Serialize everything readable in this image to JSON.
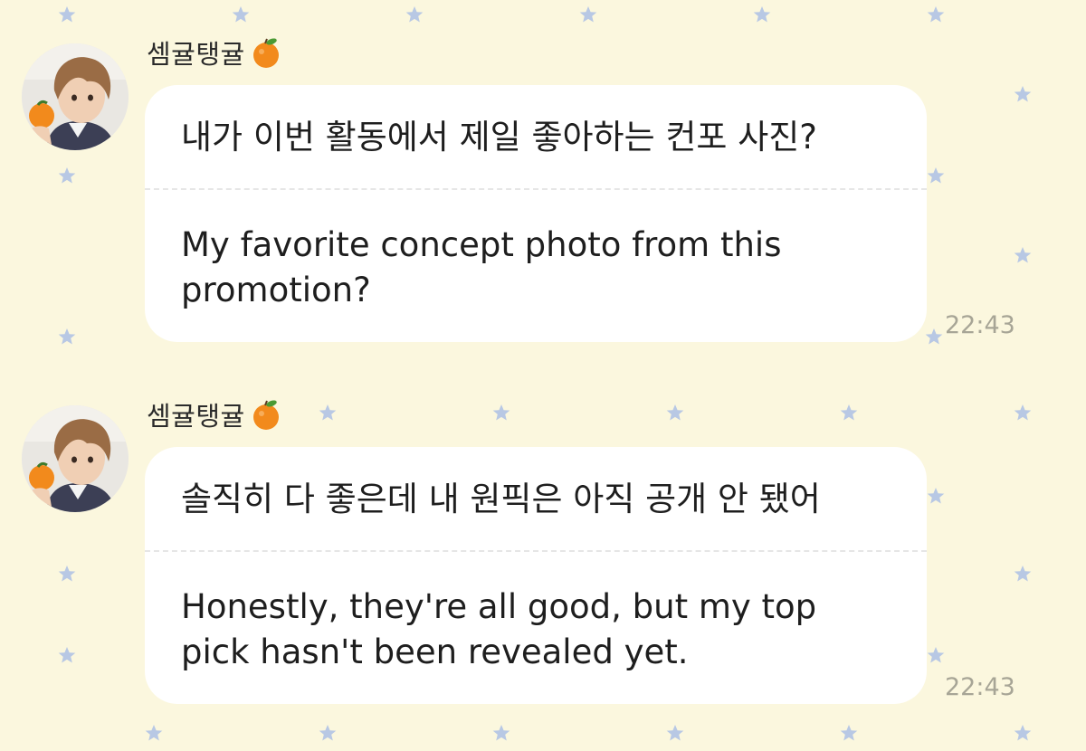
{
  "theme": {
    "background": "#fbf7de",
    "star_color": "#b8c8e4",
    "bubble_color": "#ffffff",
    "tangerine_color": "#f28a1c"
  },
  "messages": [
    {
      "sender": "셈귤탱귤",
      "sender_icon": "tangerine-icon",
      "korean": "내가 이번 활동에서 제일 좋아하는 컨포 사진?",
      "english": "My favorite concept photo from this promotion?",
      "time": "22:43"
    },
    {
      "sender": "셈귤탱귤",
      "sender_icon": "tangerine-icon",
      "korean": "솔직히 다 좋은데 내 원픽은 아직 공개 안 됐어",
      "english": "Honestly, they're all good, but my top pick hasn't been revealed yet.",
      "time": "22:43"
    }
  ]
}
